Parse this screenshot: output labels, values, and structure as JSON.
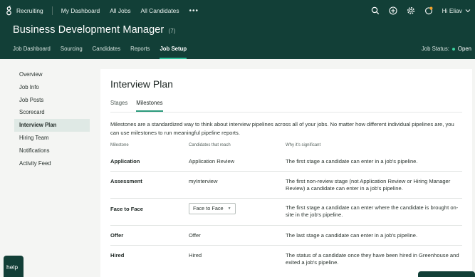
{
  "topbar": {
    "app_name": "Recruiting",
    "links": [
      "My Dashboard",
      "All Jobs",
      "All Candidates"
    ],
    "more": "•••",
    "user_greeting": "Hi Eliav"
  },
  "job": {
    "title": "Business Development Manager",
    "count": "(7)",
    "subnav": [
      "Job Dashboard",
      "Sourcing",
      "Candidates",
      "Reports",
      "Job Setup"
    ],
    "active_subnav": "Job Setup",
    "status_label": "Job Status:",
    "status_value": "Open",
    "status_color": "#3ad29f"
  },
  "sidenav": {
    "items": [
      "Overview",
      "Job Info",
      "Job Posts",
      "Scorecard",
      "Interview Plan",
      "Hiring Team",
      "Notifications",
      "Activity Feed"
    ],
    "active": "Interview Plan"
  },
  "main": {
    "title": "Interview Plan",
    "tabs": [
      "Stages",
      "Milestones"
    ],
    "active_tab": "Milestones",
    "description": "Milestones are a standardized way to think about interview pipelines across all of your jobs. No matter how different individual pipelines are, you can use milestones to run meaningful pipeline reports.",
    "columns": [
      "Milestone",
      "Candidates that reach",
      "Why it's significant"
    ],
    "rows": [
      {
        "milestone": "Application",
        "reach": "Application Review",
        "significance": "The first stage a candidate can enter in a job's pipeline."
      },
      {
        "milestone": "Assessment",
        "reach": "myInterview",
        "significance": "The first non-review stage (not Application Review or Hiring Manager Review) a candidate can enter in a job's pipeline."
      },
      {
        "milestone": "Face to Face",
        "reach": "Face to Face",
        "significance": "The first stage a candidate can enter where the candidate is brought on-site in the job's pipeline."
      },
      {
        "milestone": "Offer",
        "reach": "Offer",
        "significance": "The last stage a candidate can enter in a job's pipeline."
      },
      {
        "milestone": "Hired",
        "reach": "Hired",
        "significance": "The status of a candidate once they have been hired in Greenhouse and exited a job's pipeline."
      }
    ]
  },
  "help": {
    "label": "help"
  },
  "colors": {
    "brand_dark": "#123f37",
    "accent": "#2a9a7b"
  }
}
